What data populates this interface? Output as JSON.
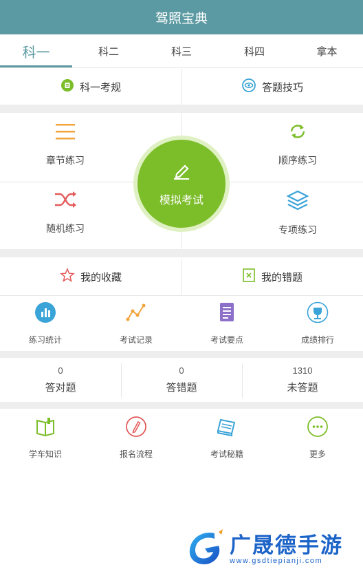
{
  "app": {
    "title": "驾照宝典"
  },
  "tabs": [
    "科一",
    "科二",
    "科三",
    "科四",
    "拿本"
  ],
  "top_links": {
    "rules": "科一考规",
    "tips": "答题技巧"
  },
  "practice": {
    "chapter": "章节练习",
    "sequence": "顺序练习",
    "random": "随机练习",
    "special": "专项练习",
    "mock": "模拟考试"
  },
  "collections": {
    "favorites": "我的收藏",
    "mistakes": "我的错题"
  },
  "tools": [
    "练习统计",
    "考试记录",
    "考试要点",
    "成绩排行"
  ],
  "stats": [
    {
      "value": "0",
      "label": "答对题"
    },
    {
      "value": "0",
      "label": "答错题"
    },
    {
      "value": "1310",
      "label": "未答题"
    }
  ],
  "bottom": [
    "学车知识",
    "报名流程",
    "考试秘籍",
    "更多"
  ],
  "watermark": {
    "brand": "广晟德手游",
    "url": "www.gsdtiepianji.com"
  },
  "colors": {
    "header": "#5b9aa2",
    "accent_green": "#7cbd2a",
    "orange": "#f2a33a",
    "red": "#e35b5b",
    "blue": "#3aa3d8",
    "purple": "#8b6fc9"
  }
}
